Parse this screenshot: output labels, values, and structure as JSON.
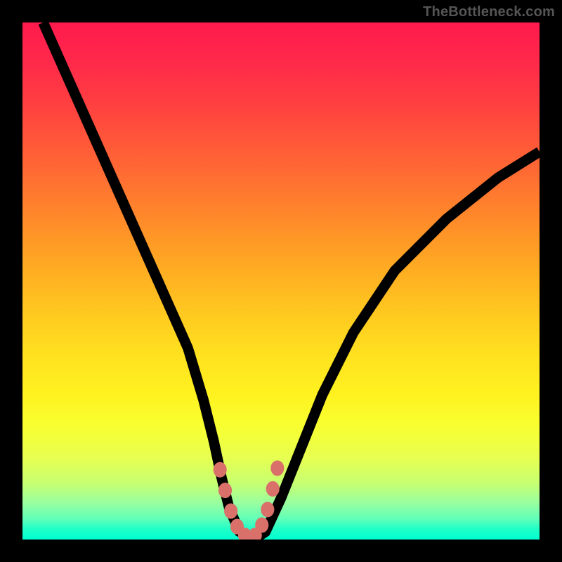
{
  "watermark": "TheBottleneck.com",
  "colors": {
    "frame_bg": "#000000",
    "watermark_text": "#555555",
    "curve_stroke": "#000000",
    "marker_fill": "#d9706a",
    "gradient_top": "#ff1a4d",
    "gradient_bottom": "#00ffd0"
  },
  "chart_data": {
    "type": "line",
    "title": "",
    "xlabel": "",
    "ylabel": "",
    "xlim": [
      0,
      100
    ],
    "ylim": [
      0,
      100
    ],
    "grid": false,
    "legend": false,
    "series": [
      {
        "name": "bottleneck-curve",
        "x": [
          4,
          8,
          12,
          16,
          20,
          24,
          28,
          32,
          35,
          37,
          38.5,
          40,
          42,
          44,
          45.5,
          47,
          50,
          54,
          58,
          64,
          72,
          82,
          92,
          100
        ],
        "values": [
          100,
          91,
          82,
          73,
          64,
          55,
          46,
          37,
          27,
          19,
          12,
          6,
          1.5,
          0.5,
          0.5,
          1.5,
          8,
          18,
          28,
          40,
          52,
          62,
          70,
          75
        ]
      }
    ],
    "markers": {
      "name": "highlight-points",
      "x": [
        38.2,
        39.2,
        40.3,
        41.5,
        43.0,
        45.0,
        46.3,
        47.4,
        48.4,
        49.3
      ],
      "values": [
        13.5,
        9.5,
        5.5,
        2.5,
        0.8,
        0.8,
        2.8,
        5.8,
        9.8,
        13.8
      ]
    },
    "annotations": [
      {
        "text": "TheBottleneck.com",
        "position": "top-right"
      }
    ]
  }
}
